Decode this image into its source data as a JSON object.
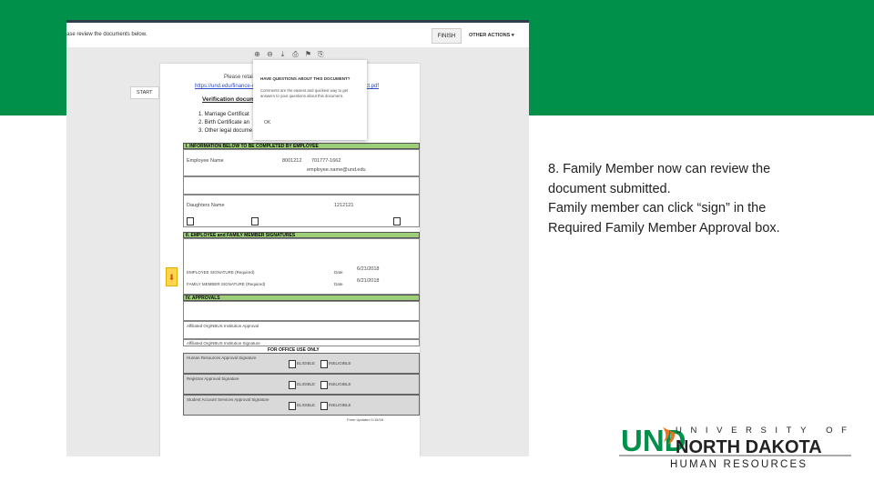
{
  "colors": {
    "banner_green": "#00904a",
    "und_green": "#00904a",
    "und_orange": "#e9741e",
    "section_green": "#9ccf78",
    "toolbar_border": "#2d3f4f"
  },
  "toolbar": {
    "message": "ase review the documents below.",
    "finish_label": "FINISH",
    "other_actions_label": "OTHER ACTIONS ▾"
  },
  "viewer_icons": [
    "zoom-in-icon",
    "zoom-out-icon",
    "download-icon",
    "print-icon",
    "flag-icon",
    "attachment-icon"
  ],
  "start_tab": "START",
  "document": {
    "intro_line": "Please retain ... Verification documents:",
    "link_text": "https://und.edu/finance-ope",
    "link_tail": "ect.pdf",
    "verification_heading": "Verification docume",
    "list": [
      "1.  Marriage Certificat",
      "2.  Birth Certificate an",
      "3.  Other legal docume"
    ],
    "section_info": "I.  INFORMATION BELOW TO BE COMPLETED BY EMPLOYEE",
    "employee_name": "Employee Name",
    "emp_id": "8001212",
    "phone": "701777-1662",
    "email": "employee.name@und.edu",
    "daughter_name": "Daughters Name",
    "student_id": "1212121",
    "section_signatures": "II.  EMPLOYEE and FAMILY MEMBER SIGNATURES",
    "date_1": "6/21/2018",
    "date_2": "6/21/2018",
    "date_label": "Date",
    "employee_sig_label": "EMPLOYEE SIGNATURE (Required)",
    "family_sig_label": "FAMILY MEMBER SIGNATURE (Required)",
    "section_approval": "IV.  APPROVALS",
    "approval_1": "Affiliated Org/NBUS Institution Approval",
    "approval_2": "Affiliated Org/NBUS Institution Signature",
    "office_use": "FOR OFFICE USE ONLY",
    "hr_label": "Human Resources Approval Signature",
    "registrar_label": "Registrar Approval Signature",
    "sas_label": "Student Account Services Approval Signature",
    "eligible": "ELIGIBLE",
    "ineligible": "INELIGIBLE",
    "footer": "Form Updated 1/15/18"
  },
  "popup": {
    "title": "HAVE QUESTIONS ABOUT THIS DOCUMENT?",
    "body": "Comments are the easiest and quickest way to get answers to your questions about this document.",
    "ok": "OK"
  },
  "caption_lines": [
    "8. Family Member now can review the",
    "document submitted.",
    "Family member can click “sign” in the",
    "Required Family Member Approval box."
  ],
  "logo": {
    "mark": "UND",
    "university_of": "UNIVERSITY OF",
    "north_dakota": "NORTH DAKOTA",
    "human_resources": "HUMAN RESOURCES"
  }
}
